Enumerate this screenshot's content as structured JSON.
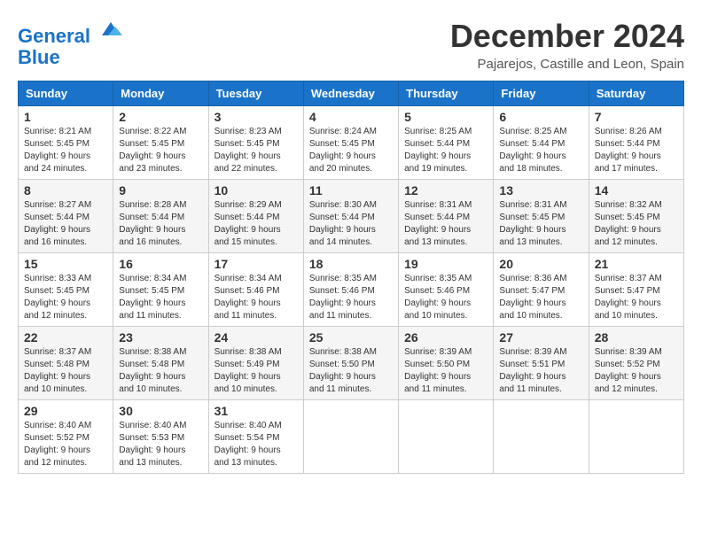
{
  "logo": {
    "line1": "General",
    "line2": "Blue"
  },
  "title": "December 2024",
  "location": "Pajarejos, Castille and Leon, Spain",
  "weekdays": [
    "Sunday",
    "Monday",
    "Tuesday",
    "Wednesday",
    "Thursday",
    "Friday",
    "Saturday"
  ],
  "weeks": [
    [
      {
        "day": "1",
        "sunrise": "8:21 AM",
        "sunset": "5:45 PM",
        "daylight": "9 hours and 24 minutes."
      },
      {
        "day": "2",
        "sunrise": "8:22 AM",
        "sunset": "5:45 PM",
        "daylight": "9 hours and 23 minutes."
      },
      {
        "day": "3",
        "sunrise": "8:23 AM",
        "sunset": "5:45 PM",
        "daylight": "9 hours and 22 minutes."
      },
      {
        "day": "4",
        "sunrise": "8:24 AM",
        "sunset": "5:45 PM",
        "daylight": "9 hours and 20 minutes."
      },
      {
        "day": "5",
        "sunrise": "8:25 AM",
        "sunset": "5:44 PM",
        "daylight": "9 hours and 19 minutes."
      },
      {
        "day": "6",
        "sunrise": "8:25 AM",
        "sunset": "5:44 PM",
        "daylight": "9 hours and 18 minutes."
      },
      {
        "day": "7",
        "sunrise": "8:26 AM",
        "sunset": "5:44 PM",
        "daylight": "9 hours and 17 minutes."
      }
    ],
    [
      {
        "day": "8",
        "sunrise": "8:27 AM",
        "sunset": "5:44 PM",
        "daylight": "9 hours and 16 minutes."
      },
      {
        "day": "9",
        "sunrise": "8:28 AM",
        "sunset": "5:44 PM",
        "daylight": "9 hours and 16 minutes."
      },
      {
        "day": "10",
        "sunrise": "8:29 AM",
        "sunset": "5:44 PM",
        "daylight": "9 hours and 15 minutes."
      },
      {
        "day": "11",
        "sunrise": "8:30 AM",
        "sunset": "5:44 PM",
        "daylight": "9 hours and 14 minutes."
      },
      {
        "day": "12",
        "sunrise": "8:31 AM",
        "sunset": "5:44 PM",
        "daylight": "9 hours and 13 minutes."
      },
      {
        "day": "13",
        "sunrise": "8:31 AM",
        "sunset": "5:45 PM",
        "daylight": "9 hours and 13 minutes."
      },
      {
        "day": "14",
        "sunrise": "8:32 AM",
        "sunset": "5:45 PM",
        "daylight": "9 hours and 12 minutes."
      }
    ],
    [
      {
        "day": "15",
        "sunrise": "8:33 AM",
        "sunset": "5:45 PM",
        "daylight": "9 hours and 12 minutes."
      },
      {
        "day": "16",
        "sunrise": "8:34 AM",
        "sunset": "5:45 PM",
        "daylight": "9 hours and 11 minutes."
      },
      {
        "day": "17",
        "sunrise": "8:34 AM",
        "sunset": "5:46 PM",
        "daylight": "9 hours and 11 minutes."
      },
      {
        "day": "18",
        "sunrise": "8:35 AM",
        "sunset": "5:46 PM",
        "daylight": "9 hours and 11 minutes."
      },
      {
        "day": "19",
        "sunrise": "8:35 AM",
        "sunset": "5:46 PM",
        "daylight": "9 hours and 10 minutes."
      },
      {
        "day": "20",
        "sunrise": "8:36 AM",
        "sunset": "5:47 PM",
        "daylight": "9 hours and 10 minutes."
      },
      {
        "day": "21",
        "sunrise": "8:37 AM",
        "sunset": "5:47 PM",
        "daylight": "9 hours and 10 minutes."
      }
    ],
    [
      {
        "day": "22",
        "sunrise": "8:37 AM",
        "sunset": "5:48 PM",
        "daylight": "9 hours and 10 minutes."
      },
      {
        "day": "23",
        "sunrise": "8:38 AM",
        "sunset": "5:48 PM",
        "daylight": "9 hours and 10 minutes."
      },
      {
        "day": "24",
        "sunrise": "8:38 AM",
        "sunset": "5:49 PM",
        "daylight": "9 hours and 10 minutes."
      },
      {
        "day": "25",
        "sunrise": "8:38 AM",
        "sunset": "5:50 PM",
        "daylight": "9 hours and 11 minutes."
      },
      {
        "day": "26",
        "sunrise": "8:39 AM",
        "sunset": "5:50 PM",
        "daylight": "9 hours and 11 minutes."
      },
      {
        "day": "27",
        "sunrise": "8:39 AM",
        "sunset": "5:51 PM",
        "daylight": "9 hours and 11 minutes."
      },
      {
        "day": "28",
        "sunrise": "8:39 AM",
        "sunset": "5:52 PM",
        "daylight": "9 hours and 12 minutes."
      }
    ],
    [
      {
        "day": "29",
        "sunrise": "8:40 AM",
        "sunset": "5:52 PM",
        "daylight": "9 hours and 12 minutes."
      },
      {
        "day": "30",
        "sunrise": "8:40 AM",
        "sunset": "5:53 PM",
        "daylight": "9 hours and 13 minutes."
      },
      {
        "day": "31",
        "sunrise": "8:40 AM",
        "sunset": "5:54 PM",
        "daylight": "9 hours and 13 minutes."
      },
      null,
      null,
      null,
      null
    ]
  ]
}
